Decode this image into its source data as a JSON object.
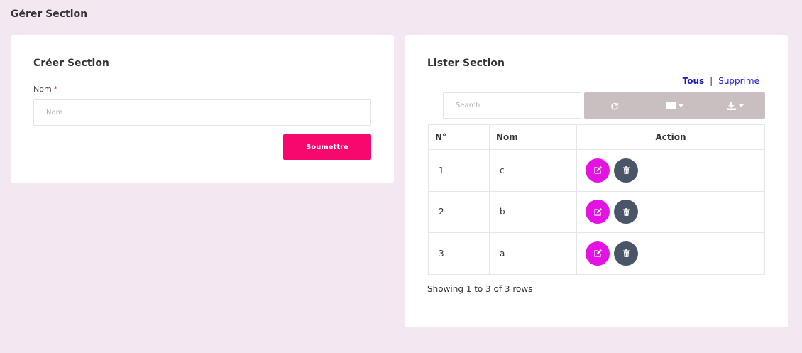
{
  "page": {
    "title": "Gérer Section"
  },
  "create": {
    "title": "Créer Section",
    "field_label": "Nom",
    "required_mark": "*",
    "input_value": "",
    "input_placeholder": "Nom",
    "submit_label": "Soumettre"
  },
  "list": {
    "title": "Lister Section",
    "filters": {
      "all_label": "Tous",
      "separator": "|",
      "deleted_label": "Supprimé"
    },
    "search": {
      "value": "",
      "placeholder": "Search"
    },
    "toolbar": {
      "refresh_icon": "refresh-icon",
      "columns_icon": "list-icon",
      "export_icon": "download-icon"
    },
    "columns": {
      "num": "N°",
      "nom": "Nom",
      "action": "Action"
    },
    "rows": [
      {
        "num": "1",
        "nom": "c"
      },
      {
        "num": "2",
        "nom": "b"
      },
      {
        "num": "3",
        "nom": "a"
      }
    ],
    "pagination_info": "Showing 1 to 3 of 3 rows"
  },
  "colors": {
    "background": "#f3e8f1",
    "submit": "#f6086e",
    "edit": "#e413e4",
    "delete": "#4a5568",
    "toolbar": "#c9bfc1",
    "link": "#2020c8"
  }
}
